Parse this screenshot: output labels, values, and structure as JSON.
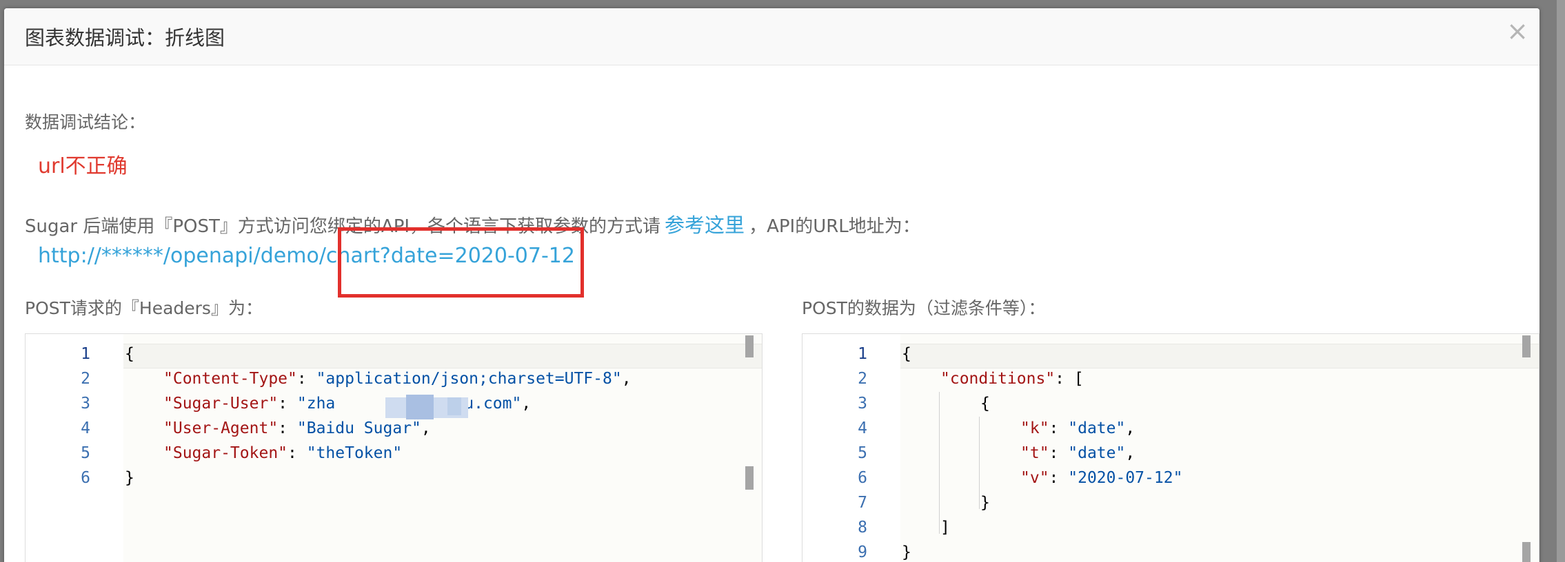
{
  "dialog": {
    "title": "图表数据调试：折线图",
    "close_label": "×"
  },
  "conclusion": {
    "label": "数据调试结论：",
    "value": "url不正确"
  },
  "description": {
    "prefix": "Sugar 后端使用『POST』方式访问您绑定的API，各个语言下获取参数的方式请",
    "link": "参考这里",
    "suffix": "，API的URL地址为："
  },
  "api_url": "http://******/openapi/demo/chart?date=2020-07-12",
  "headers_panel": {
    "label": "POST请求的『Headers』为：",
    "line_numbers": [
      "1",
      "2",
      "3",
      "4",
      "5",
      "6"
    ],
    "lines": {
      "l1": "{",
      "k2": "\"Content-Type\"",
      "v2": "\"application/json;charset=UTF-8\"",
      "k3": "\"Sugar-User\"",
      "v3a": "\"zha",
      "v3b": "u.com\"",
      "k4": "\"User-Agent\"",
      "v4": "\"Baidu Sugar\"",
      "k5": "\"Sugar-Token\"",
      "v5": "\"theToken\"",
      "l6": "}"
    }
  },
  "body_panel": {
    "label": "POST的数据为（过滤条件等）：",
    "line_numbers": [
      "1",
      "2",
      "3",
      "4",
      "5",
      "6",
      "7",
      "8",
      "9"
    ],
    "lines": {
      "l1": "{",
      "k2": "\"conditions\"",
      "p2": ": [",
      "l3": "{",
      "k4": "\"k\"",
      "v4": "\"date\"",
      "k5": "\"t\"",
      "v5": "\"date\"",
      "k6": "\"v\"",
      "v6": "\"2020-07-12\"",
      "l7": "}",
      "l8": "]",
      "l9": "}"
    }
  }
}
